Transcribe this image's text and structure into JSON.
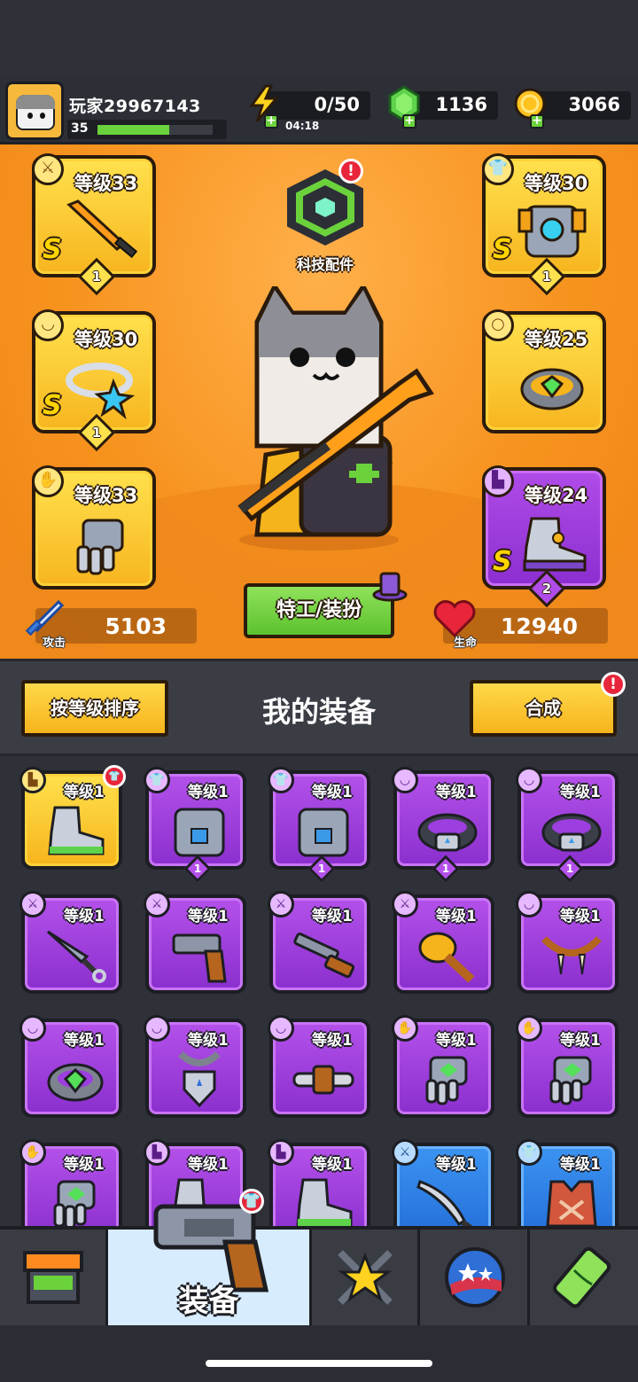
{
  "player": {
    "name": "玩家29967143",
    "level": "35",
    "xp_fraction": 0.62
  },
  "resources": {
    "energy": {
      "value": "0/50",
      "timer": "04:18"
    },
    "gems": {
      "value": "1136"
    },
    "coins": {
      "value": "3066"
    }
  },
  "hero": {
    "tech_label": "科技配件",
    "tech_alert": "!",
    "agent_button": "特工/装扮",
    "attack": {
      "label": "攻击",
      "value": "5103"
    },
    "life": {
      "label": "生命",
      "value": "12940"
    },
    "slots": [
      {
        "level": "等级33",
        "grade": "S",
        "star": "1",
        "rarity": "yellow",
        "icon": "sword-icon"
      },
      {
        "level": "等级30",
        "grade": "S",
        "star": "1",
        "rarity": "yellow",
        "icon": "armor-icon"
      },
      {
        "level": "等级30",
        "grade": "S",
        "star": "1",
        "rarity": "yellow",
        "icon": "necklace-icon"
      },
      {
        "level": "等级25",
        "grade": "",
        "star": "",
        "rarity": "yellow",
        "icon": "ring-icon"
      },
      {
        "level": "等级33",
        "grade": "",
        "star": "",
        "rarity": "yellow",
        "icon": "glove-icon"
      },
      {
        "level": "等级24",
        "grade": "S",
        "star": "2",
        "rarity": "purple",
        "icon": "boot-icon"
      }
    ]
  },
  "inventory": {
    "sort_button": "按等级排序",
    "title": "我的装备",
    "merge_button": "合成",
    "merge_alert": "!",
    "items": [
      {
        "level": "等级1",
        "rarity": "yellow",
        "icon": "boot-icon",
        "star": "",
        "badge": "armor-icon"
      },
      {
        "level": "等级1",
        "rarity": "purple",
        "icon": "armor-icon",
        "star": "1"
      },
      {
        "level": "等级1",
        "rarity": "purple",
        "icon": "armor-icon",
        "star": "1"
      },
      {
        "level": "等级1",
        "rarity": "purple",
        "icon": "belt-icon",
        "star": "1"
      },
      {
        "level": "等级1",
        "rarity": "purple",
        "icon": "belt-icon",
        "star": "1"
      },
      {
        "level": "等级1",
        "rarity": "purple",
        "icon": "kunai-icon",
        "star": ""
      },
      {
        "level": "等级1",
        "rarity": "purple",
        "icon": "revolver-icon",
        "star": ""
      },
      {
        "level": "等级1",
        "rarity": "purple",
        "icon": "shotgun-icon",
        "star": ""
      },
      {
        "level": "等级1",
        "rarity": "purple",
        "icon": "club-icon",
        "star": ""
      },
      {
        "level": "等级1",
        "rarity": "purple",
        "icon": "fang-necklace-icon",
        "star": ""
      },
      {
        "level": "等级1",
        "rarity": "purple",
        "icon": "ring-icon",
        "star": ""
      },
      {
        "level": "等级1",
        "rarity": "purple",
        "icon": "shield-pendant-icon",
        "star": ""
      },
      {
        "level": "等级1",
        "rarity": "purple",
        "icon": "bone-belt-icon",
        "star": ""
      },
      {
        "level": "等级1",
        "rarity": "purple",
        "icon": "glove-icon",
        "star": ""
      },
      {
        "level": "等级1",
        "rarity": "purple",
        "icon": "glove-icon",
        "star": ""
      },
      {
        "level": "等级1",
        "rarity": "purple",
        "icon": "glove-icon",
        "star": ""
      },
      {
        "level": "等级1",
        "rarity": "purple",
        "icon": "boot-icon",
        "star": ""
      },
      {
        "level": "等级1",
        "rarity": "purple",
        "icon": "boot-icon",
        "star": ""
      },
      {
        "level": "等级1",
        "rarity": "blue",
        "icon": "machete-icon",
        "star": ""
      },
      {
        "level": "等级1",
        "rarity": "blue",
        "icon": "vest-icon",
        "star": ""
      }
    ]
  },
  "nav": {
    "items": [
      {
        "name": "shop",
        "label": "",
        "icon": "shop-icon"
      },
      {
        "name": "equipment",
        "label": "装备",
        "icon": "revolver-icon",
        "active": true
      },
      {
        "name": "heroes",
        "label": "",
        "icon": "star-swords-icon"
      },
      {
        "name": "world",
        "label": "",
        "icon": "planet-icon"
      },
      {
        "name": "lab",
        "label": "",
        "icon": "dna-capsule-icon"
      }
    ]
  },
  "colors": {
    "accent_orange": "#f7931f",
    "gem_green": "#6bd23c",
    "alert_red": "#e8253a",
    "rarity_purple": "#8c2ed0",
    "rarity_yellow": "#f6b41c",
    "rarity_blue": "#236ed8"
  }
}
